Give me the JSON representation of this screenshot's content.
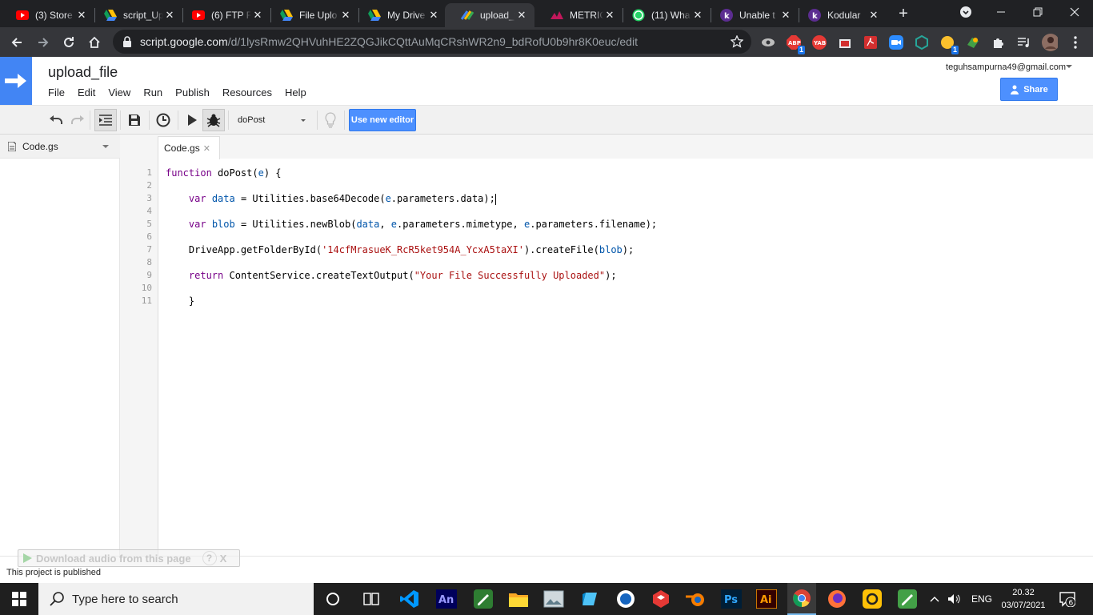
{
  "browser": {
    "tabs": [
      {
        "title": "(3) Store",
        "icon": "youtube-icon"
      },
      {
        "title": "script_Up",
        "icon": "google-drive-icon"
      },
      {
        "title": "(6) FTP F",
        "icon": "youtube-icon"
      },
      {
        "title": "File Uplo",
        "icon": "google-drive-icon"
      },
      {
        "title": "My Drive",
        "icon": "google-drive-icon"
      },
      {
        "title": "upload_f",
        "icon": "apps-script-icon"
      },
      {
        "title": "METRIC",
        "icon": "metric-icon"
      },
      {
        "title": "(11) Wha",
        "icon": "whatsapp-icon"
      },
      {
        "title": "Unable t",
        "icon": "kodular-icon"
      },
      {
        "title": "Kodular",
        "icon": "kodular-icon"
      }
    ],
    "active_tab": 5,
    "url_host": "script.google.com",
    "url_path": "/d/1lysRmw2QHVuhHE2ZQGJikCQttAuMqCRshWR2n9_bdRofU0b9hr8K0euc/edit",
    "ext_badges": {
      "abp": "1",
      "abp_label": "ABP",
      "yab_label": "YAB",
      "notes": "1"
    }
  },
  "app": {
    "project_title": "upload_file",
    "menu": [
      "File",
      "Edit",
      "View",
      "Run",
      "Publish",
      "Resources",
      "Help"
    ],
    "account": "teguhsampurna49@gmail.com",
    "share_label": "Share",
    "function_select": "doPost",
    "new_editor_label": "Use new editor",
    "files": [
      "Code.gs"
    ],
    "editor_tab": "Code.gs",
    "line_numbers": [
      "1",
      "2",
      "3",
      "4",
      "5",
      "6",
      "7",
      "8",
      "9",
      "10",
      "11"
    ],
    "status": "This project is published",
    "download_bar": "Download audio from this page",
    "download_help": "?",
    "download_close": "X"
  },
  "code": {
    "l1": {
      "kw": "function",
      "name": " doPost(",
      "arg": "e",
      "end": ") {"
    },
    "l3": {
      "kw": "var",
      "v": " data",
      "a": " = Utilities.base64Decode(",
      "e": "e",
      "b": ".parameters.data);"
    },
    "l5": {
      "kw": "var",
      "v": " blob",
      "a": " = Utilities.newBlob(",
      "d": "data",
      "c1": ", ",
      "e1": "e",
      "m": ".parameters.mimetype, ",
      "e2": "e",
      "f": ".parameters.filename);"
    },
    "l7": {
      "a": "DriveApp.getFolderById(",
      "s": "'14cfMrasueK_RcR5ket954A_YcxA5taXI'",
      "b": ").createFile(",
      "v": "blob",
      "c": ");"
    },
    "l9": {
      "kw": "return",
      "a": " ContentService.createTextOutput(",
      "s": "\"Your File Successfully Uploaded\"",
      "b": ");"
    },
    "l11": {
      "a": "}"
    }
  },
  "taskbar": {
    "search_placeholder": "Type here to search",
    "lang": "ENG",
    "time": "20.32",
    "date": "03/07/2021",
    "notif_count": "6",
    "app_an": "An",
    "app_ps": "Ps",
    "app_ai": "Ai"
  },
  "colors": {
    "accent": "#4d90fe",
    "logo": "#4285f4",
    "keyword": "#770088",
    "variable": "#0055aa",
    "string": "#aa1111"
  }
}
